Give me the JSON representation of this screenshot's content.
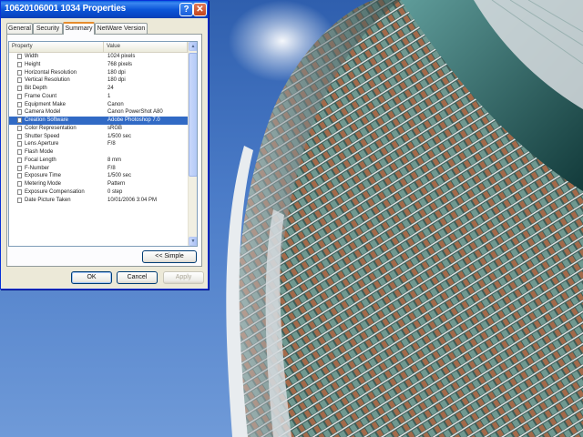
{
  "window": {
    "title": "10620106001 1034 Properties",
    "help_glyph": "?",
    "close_glyph": "✕"
  },
  "tabs": [
    {
      "label": "General",
      "active": false
    },
    {
      "label": "Security",
      "active": false
    },
    {
      "label": "Summary",
      "active": true
    },
    {
      "label": "NetWare Version",
      "active": false
    }
  ],
  "list": {
    "columns": {
      "property": "Property",
      "value": "Value"
    },
    "rows": [
      {
        "property": "Width",
        "value": "1024 pixels",
        "selected": false
      },
      {
        "property": "Height",
        "value": "768 pixels",
        "selected": false
      },
      {
        "property": "Horizontal Resolution",
        "value": "180 dpi",
        "selected": false
      },
      {
        "property": "Vertical Resolution",
        "value": "180 dpi",
        "selected": false
      },
      {
        "property": "Bit Depth",
        "value": "24",
        "selected": false
      },
      {
        "property": "Frame Count",
        "value": "1",
        "selected": false
      },
      {
        "property": "Equipment Make",
        "value": "Canon",
        "selected": false
      },
      {
        "property": "Camera Model",
        "value": "Canon PowerShot A80",
        "selected": false
      },
      {
        "property": "Creation Software",
        "value": "Adobe Photoshop 7.0",
        "selected": true
      },
      {
        "property": "Color Representation",
        "value": "sRGB",
        "selected": false
      },
      {
        "property": "Shutter Speed",
        "value": "1/500 sec",
        "selected": false
      },
      {
        "property": "Lens Aperture",
        "value": "F/8",
        "selected": false
      },
      {
        "property": "Flash Mode",
        "value": "",
        "selected": false
      },
      {
        "property": "Focal Length",
        "value": "8 mm",
        "selected": false
      },
      {
        "property": "F-Number",
        "value": "F/8",
        "selected": false
      },
      {
        "property": "Exposure Time",
        "value": "1/500 sec",
        "selected": false
      },
      {
        "property": "Metering Mode",
        "value": "Pattern",
        "selected": false
      },
      {
        "property": "Exposure Compensation",
        "value": "0 step",
        "selected": false
      },
      {
        "property": "Date Picture Taken",
        "value": "10/01/2006 3:04 PM",
        "selected": false
      }
    ]
  },
  "buttons": {
    "simple": "<< Simple",
    "ok": "OK",
    "cancel": "Cancel",
    "apply": "Apply"
  },
  "scrollbar": {
    "up_glyph": "▲",
    "down_glyph": "▼"
  },
  "colors": {
    "selection": "#316ac5",
    "titlebar": "#0a5fe0"
  }
}
